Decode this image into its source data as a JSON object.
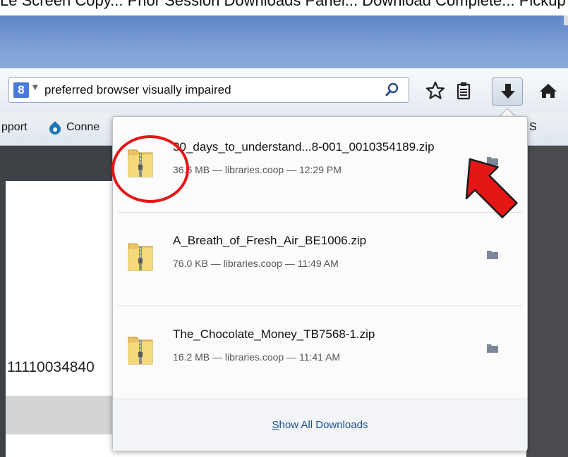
{
  "window": {
    "caption": "Le Screen Copy... Prior Session Downloads Panel... Download Complete... Pickup"
  },
  "search": {
    "engine_label": "8",
    "query": "preferred browser visually impaired"
  },
  "bookmarks": {
    "items": [
      "pport",
      "Conne",
      "S"
    ]
  },
  "page": {
    "partial_number": "11110034840"
  },
  "downloads": {
    "items": [
      {
        "name": "30_days_to_understand...8-001_0010354189.zip",
        "meta": "36.6 MB — libraries.coop — 12:29 PM"
      },
      {
        "name": "A_Breath_of_Fresh_Air_BE1006.zip",
        "meta": "76.0 KB — libraries.coop — 11:49 AM"
      },
      {
        "name": "The_Chocolate_Money_TB7568-1.zip",
        "meta": "16.2 MB — libraries.coop — 11:41 AM"
      }
    ],
    "show_all_prefix": "S",
    "show_all_rest": "how All Downloads"
  },
  "colors": {
    "annotation": "#e51616",
    "link": "#1a4e9a",
    "titlebar": "#7ea0d6"
  },
  "icons": {
    "search_engine": "google-icon",
    "search_go": "magnifier-icon",
    "bookmark": "star-icon",
    "reader": "clipboard-icon",
    "downloads": "download-arrow-icon",
    "home": "home-icon",
    "file": "zip-folder-icon",
    "open_folder": "folder-icon"
  }
}
